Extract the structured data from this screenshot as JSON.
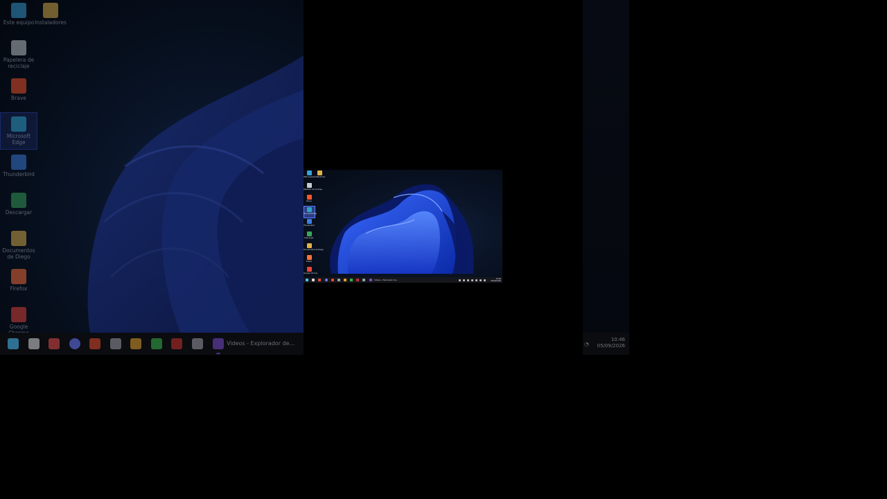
{
  "desktop_icons": [
    {
      "label": "Este equipo",
      "icon": "computer-icon",
      "color": "#3aa0d8"
    },
    {
      "label": "Instaladores",
      "icon": "folder-icon",
      "color": "#e0b24a"
    },
    {
      "label": "Papelera de reciclaje",
      "icon": "recycle-bin-icon",
      "color": "#c8ccd2"
    },
    {
      "label": "Brave",
      "icon": "brave-icon",
      "color": "#fb542b"
    },
    {
      "label": "Microsoft Edge",
      "icon": "edge-icon",
      "color": "#2fa3c4"
    },
    {
      "label": "Thunderbird",
      "icon": "thunderbird-icon",
      "color": "#3e7ee0"
    },
    {
      "label": "Descargar",
      "icon": "download-icon",
      "color": "#3ba55d"
    },
    {
      "label": "Documentos de Diego",
      "icon": "folder-icon",
      "color": "#e0b24a"
    },
    {
      "label": "Firefox",
      "icon": "firefox-icon",
      "color": "#ff7139"
    },
    {
      "label": "Google Chrome",
      "icon": "chrome-icon",
      "color": "#e8453c"
    }
  ],
  "taskbar": {
    "active_window_label": "Videos - Explorador de...",
    "icons": [
      {
        "name": "start-icon",
        "color": "#4cc2ff"
      },
      {
        "name": "file-explorer-icon",
        "color": "#d9d9d9"
      },
      {
        "name": "pen-icon",
        "color": "#e24b4b"
      },
      {
        "name": "obs-icon",
        "color": "#6b7cff"
      },
      {
        "name": "paint-icon",
        "color": "#e04b2b"
      },
      {
        "name": "apps-icon",
        "color": "#9aa0a8"
      },
      {
        "name": "game-icon",
        "color": "#e0a030"
      },
      {
        "name": "store-icon",
        "color": "#39b54a"
      },
      {
        "name": "antivirus-icon",
        "color": "#c8322b"
      },
      {
        "name": "clipboard-icon",
        "color": "#9aa0a8"
      },
      {
        "name": "explorer-window-icon",
        "color": "#7a4bd0"
      }
    ]
  },
  "clock": {
    "time": "10:46",
    "date": "05/09/2026"
  }
}
